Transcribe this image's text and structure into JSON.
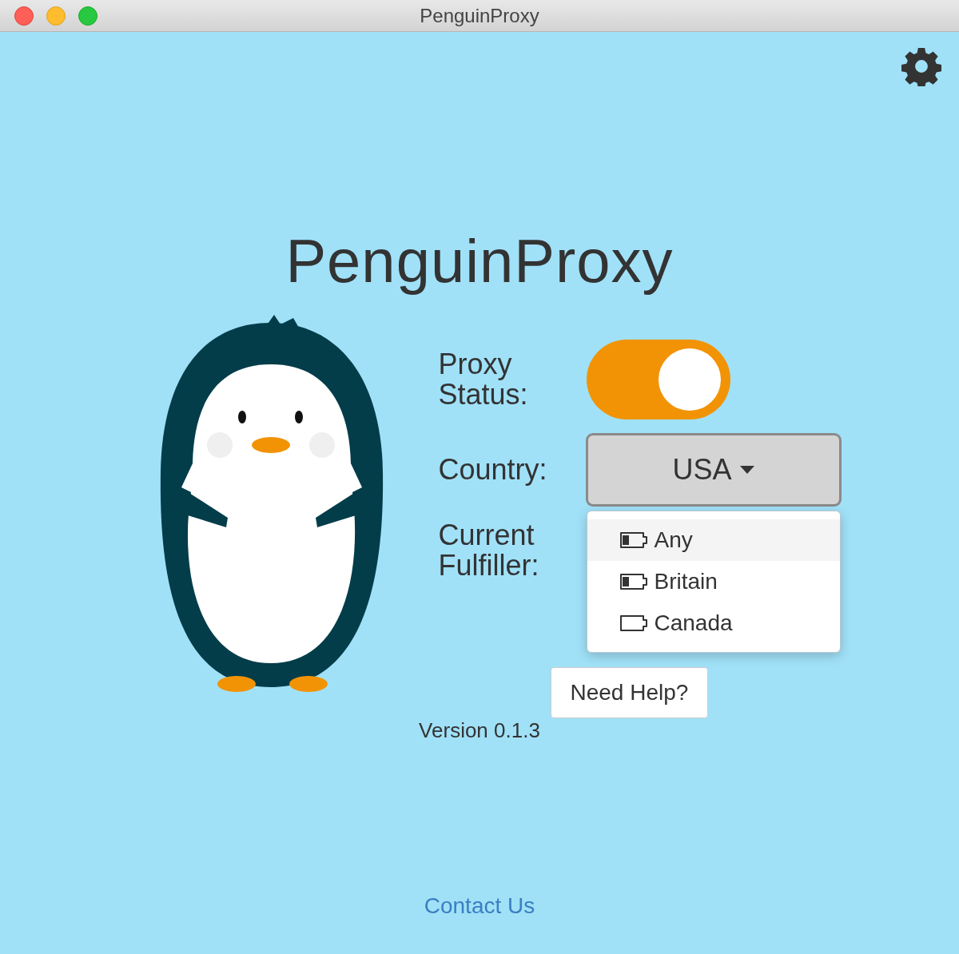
{
  "window": {
    "title": "PenguinProxy"
  },
  "app_title": "PenguinProxy",
  "proxy_status": {
    "label": "Proxy Status:",
    "on": true
  },
  "country": {
    "label": "Country:",
    "value": "USA",
    "expanded": true,
    "options": [
      {
        "label": "Any",
        "highlighted": true,
        "kind": "low"
      },
      {
        "label": "Britain",
        "highlighted": false,
        "kind": "low"
      },
      {
        "label": "Canada",
        "highlighted": false,
        "kind": "empty"
      }
    ]
  },
  "fulfiller": {
    "label": "Current Fulfiller:"
  },
  "help_button": "Need Help?",
  "version": "Version 0.1.3",
  "contact_link": "Contact Us"
}
